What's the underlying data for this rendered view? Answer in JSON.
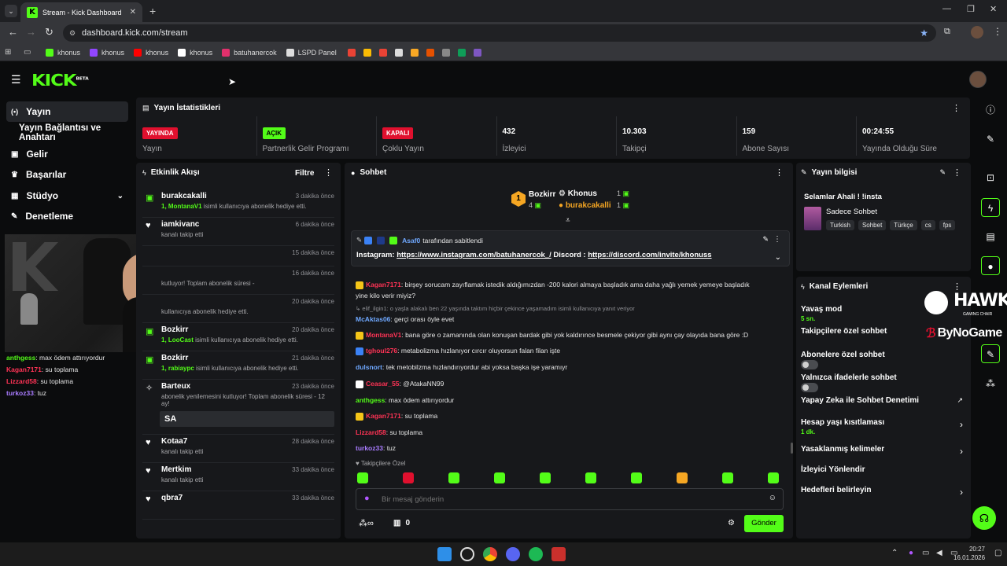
{
  "browser": {
    "tab_title": "Stream - Kick Dashboard",
    "url": "dashboard.kick.com/stream",
    "bookmarks": [
      {
        "label": "khonus",
        "color": "#53fc18"
      },
      {
        "label": "khonus",
        "color": "#9146ff"
      },
      {
        "label": "khonus",
        "color": "#ff0000"
      },
      {
        "label": "khonus",
        "color": "#ffffff"
      },
      {
        "label": "batuhanercok",
        "color": "#e1306c"
      },
      {
        "label": "LSPD Panel",
        "color": "#dddddd"
      }
    ]
  },
  "brand": {
    "logo": "KICK",
    "beta": "BETA",
    "accent": "#53fc18"
  },
  "sidebar": {
    "items": [
      {
        "label": "Yayın",
        "icon": "broadcast-icon"
      },
      {
        "label": "Yayın Bağlantısı ve Anahtarı",
        "icon": ""
      },
      {
        "label": "Gelir",
        "icon": "dollar-icon"
      },
      {
        "label": "Başarılar",
        "icon": "trophy-icon"
      },
      {
        "label": "Stüdyo",
        "icon": "studio-icon"
      },
      {
        "label": "Denetleme",
        "icon": "wrench-icon"
      }
    ]
  },
  "webcam_chat": [
    {
      "user": "anthgess",
      "msg": ": max ödem attırıyordur",
      "color": "#53fc18"
    },
    {
      "user": "Kagan7171",
      "msg": ": su toplama",
      "color": "#ff3355"
    },
    {
      "user": "Lizzard58",
      "msg": ": su toplama",
      "color": "#ff3355"
    },
    {
      "user": "turkoz33",
      "msg": ": tuz",
      "color": "#a97cff"
    }
  ],
  "stats": {
    "title": "Yayın İstatistikleri",
    "cols": [
      {
        "badge": "YAYINDA",
        "badge_color": "#e0102e",
        "label": "Yayın"
      },
      {
        "badge": "AÇIK",
        "badge_color": "#53fc18",
        "label": "Partnerlik Gelir Programı"
      },
      {
        "badge": "KAPALI",
        "badge_color": "#e0102e",
        "label": "Çoklu Yayın"
      },
      {
        "value": "432",
        "label": "İzleyici"
      },
      {
        "value": "10.303",
        "label": "Takipçi"
      },
      {
        "value": "159",
        "label": "Abone Sayısı"
      },
      {
        "value": "00:24:55",
        "label": "Yayında Olduğu Süre"
      }
    ]
  },
  "activity": {
    "title": "Etkinlik Akışı",
    "filter": "Filtre",
    "items": [
      {
        "name": "burakcakalli",
        "time": "3 dakika önce",
        "sub_hl": "1, MontanaV1",
        "sub": " isimli kullanıcıya abonelik hediye etti.",
        "icon": "gift"
      },
      {
        "name": "iamkivanc",
        "time": "6 dakika önce",
        "sub_hl": "",
        "sub": "kanalı takip etti",
        "icon": "heart"
      },
      {
        "name": "",
        "time": "15 dakika önce",
        "sub_hl": "",
        "sub": "",
        "icon": ""
      },
      {
        "name": "",
        "time": "16 dakika önce",
        "sub_hl": "",
        "sub": "kutluyor! Toplam abonelik süresi -",
        "icon": ""
      },
      {
        "name": "",
        "time": "20 dakika önce",
        "sub_hl": "",
        "sub": "kullanıcıya abonelik hediye etti.",
        "icon": ""
      },
      {
        "name": "Bozkirr",
        "time": "20 dakika önce",
        "sub_hl": "1, LooCast",
        "sub": " isimli kullanıcıya abonelik hediye etti.",
        "icon": "gift"
      },
      {
        "name": "Bozkirr",
        "time": "21 dakika önce",
        "sub_hl": "1, rabiaypc",
        "sub": " isimli kullanıcıya abonelik hediye etti.",
        "icon": "gift"
      },
      {
        "name": "Barteux",
        "time": "23 dakika önce",
        "sub_hl": "",
        "sub": "abonelik yenilemesini kutluyor! Toplam abonelik süresi - 12 ay!",
        "icon": "star",
        "msg": "SA"
      },
      {
        "name": "Kotaa7",
        "time": "28 dakika önce",
        "sub_hl": "",
        "sub": "kanalı takip etti",
        "icon": "heart"
      },
      {
        "name": "Mertkim",
        "time": "33 dakika önce",
        "sub_hl": "",
        "sub": "kanalı takip etti",
        "icon": "heart"
      },
      {
        "name": "qbra7",
        "time": "33 dakika önce",
        "sub_hl": "",
        "sub": "",
        "icon": "heart"
      }
    ]
  },
  "chat": {
    "title": "Sohbet",
    "leaders": [
      {
        "rank": "1",
        "name": "Bozkirr",
        "count": "4"
      },
      {
        "name": "Khonus",
        "count": "1"
      },
      {
        "name": "burakcakalli",
        "count": "1"
      }
    ],
    "pinned": {
      "by": "Asaf0",
      "by_text": " tarafından sabitlendi",
      "prefix": "Instagram: ",
      "link1": "https://www.instagram.com/batuhanercok_/",
      "mid": " Discord : ",
      "link2": "https://discord.com/invite/khonuss"
    },
    "messages": [
      {
        "user": "Kagan7171",
        "color": "#ff3355",
        "text": ": birşey sorucam zayıflamak istedik aldığımızdan -200 kalori almaya başladık ama daha yağlı yemek yemeye başladık",
        "badge": "#f5c518"
      },
      {
        "user": "",
        "color": "",
        "text": "yine kilo verir miyiz?",
        "badge": ""
      },
      {
        "user": "↳ elif_ilgin1: o yaşla alakalı ben 22 yaşında taktım hiçbir çekince yaşamadım isimli kullanıcıya yanıt veriyor",
        "color": "#8f9095",
        "text": "",
        "badge": ""
      },
      {
        "user": "McAktas06",
        "color": "#6fa8ff",
        "text": ": gerçi orası öyle evet",
        "badge": ""
      },
      {
        "user": "MontanaV1",
        "color": "#ff3355",
        "text": ": bana göre o zamanında olan konuşan bardak gibi yok kaldırınce besmele çekiyor gibi aynı çay olayıda bana göre :D",
        "badge": "#f5c518"
      },
      {
        "user": "tghoul276",
        "color": "#ff3355",
        "text": ": metabolizma hızlanıyor cırcır oluyorsun falan filan işte",
        "badge": "#3b82f6"
      },
      {
        "user": "dulsnort",
        "color": "#6fa8ff",
        "text": ": tek metobilzma hızlandırıyordur abi yoksa başka işe yaramıyr",
        "badge": ""
      },
      {
        "user": "Ceasar_55",
        "color": "#ff3355",
        "text": ": @AtakaNN99",
        "badge": "#ffffff"
      },
      {
        "user": "anthgess",
        "color": "#53fc18",
        "text": ": max ödem attırıyordur",
        "badge": ""
      },
      {
        "user": "Kagan7171",
        "color": "#ff3355",
        "text": ": su toplama",
        "badge": "#f5c518"
      },
      {
        "user": "Lizzard58",
        "color": "#ff3355",
        "text": ": su toplama",
        "badge": ""
      },
      {
        "user": "turkoz33",
        "color": "#a97cff",
        "text": ": tuz",
        "badge": ""
      }
    ],
    "followers_only": "Takipçilere Özel",
    "placeholder": "Bir mesaj gönderin",
    "send": "Gönder",
    "points": "0"
  },
  "info": {
    "title": "Yayın bilgisi",
    "stream_title": "Selamlar Ahali ! !insta",
    "category": "Sadece Sohbet",
    "tags": [
      "Turkish",
      "Sohbet",
      "Türkçe",
      "cs",
      "fps"
    ]
  },
  "channel": {
    "title": "Kanal Eylemleri",
    "items": [
      {
        "label": "Yavaş mod",
        "sub": "5 sn.",
        "ctrl": ""
      },
      {
        "label": "Takipçilere özel sohbet",
        "sub": "",
        "ctrl": ""
      },
      {
        "label": "Abonelere özel sohbet",
        "sub": "",
        "ctrl": "toggle"
      },
      {
        "label": "Yalnızca ifadelerle sohbet",
        "sub": "",
        "ctrl": "toggle"
      },
      {
        "label": "Yapay Zeka ile Sohbet Denetimi",
        "sub": "",
        "ctrl": "chart"
      },
      {
        "label": "Hesap yaşı kısıtlaması",
        "sub": "1 dk.",
        "ctrl": "chevron"
      },
      {
        "label": "Yasaklanmış kelimeler",
        "sub": "",
        "ctrl": "chevron"
      },
      {
        "label": "İzleyici Yönlendir",
        "sub": "",
        "ctrl": ""
      },
      {
        "label": "Hedefleri belirleyin",
        "sub": "",
        "ctrl": "chevron"
      }
    ]
  },
  "overlay": {
    "hawk": "HAWK",
    "hawk_sub": "GAMING CHAIR",
    "bynogame": "ByNoGame"
  },
  "taskbar": {
    "time": "20:27",
    "date": "16.01.2026"
  }
}
